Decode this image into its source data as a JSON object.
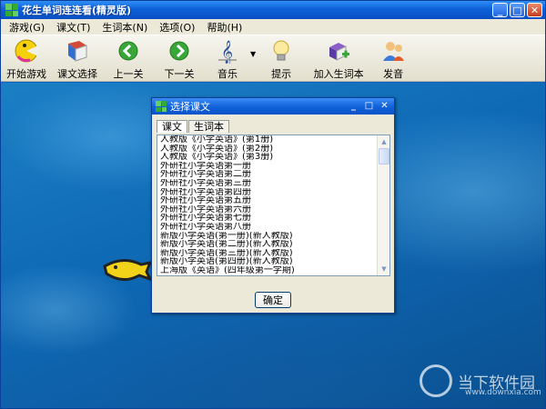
{
  "window": {
    "title": "花生单词连连看(精灵版)",
    "min": "_",
    "max": "□",
    "close": "✕"
  },
  "menu": [
    {
      "label": "游戏(G)"
    },
    {
      "label": "课文(T)"
    },
    {
      "label": "生词本(N)"
    },
    {
      "label": "选项(O)"
    },
    {
      "label": "帮助(H)"
    }
  ],
  "toolbar": {
    "start": "开始游戏",
    "lesson": "课文选择",
    "prev": "上一关",
    "next": "下一关",
    "music": "音乐",
    "music_dropdown": "▼",
    "hint": "提示",
    "add_word": "加入生词本",
    "speak": "发音"
  },
  "dialog": {
    "title": "选择课文",
    "min": "_",
    "max": "□",
    "close": "✕",
    "tabs": [
      "课文",
      "生词本"
    ],
    "items": [
      "人教版《小学英语》(第1册)",
      "人教版《小学英语》(第2册)",
      "人教版《小学英语》(第3册)",
      "外研社小学英语第一册",
      "外研社小学英语第二册",
      "外研社小学英语第三册",
      "外研社小学英语第四册",
      "外研社小学英语第五册",
      "外研社小学英语第六册",
      "外研社小学英语第七册",
      "外研社小学英语第八册",
      "新版小学英语(第一册)(新人教版)",
      "新版小学英语(第二册)(新人教版)",
      "新版小学英语(第三册)(新人教版)",
      "新版小学英语(第四册)(新人教版)",
      "上海版《英语》(四年级第一学期)"
    ],
    "ok": "确定",
    "scroll_up": "▲",
    "scroll_down": "▼"
  },
  "watermark": {
    "brand": "当下软件园",
    "url": "www.downxia.com"
  }
}
